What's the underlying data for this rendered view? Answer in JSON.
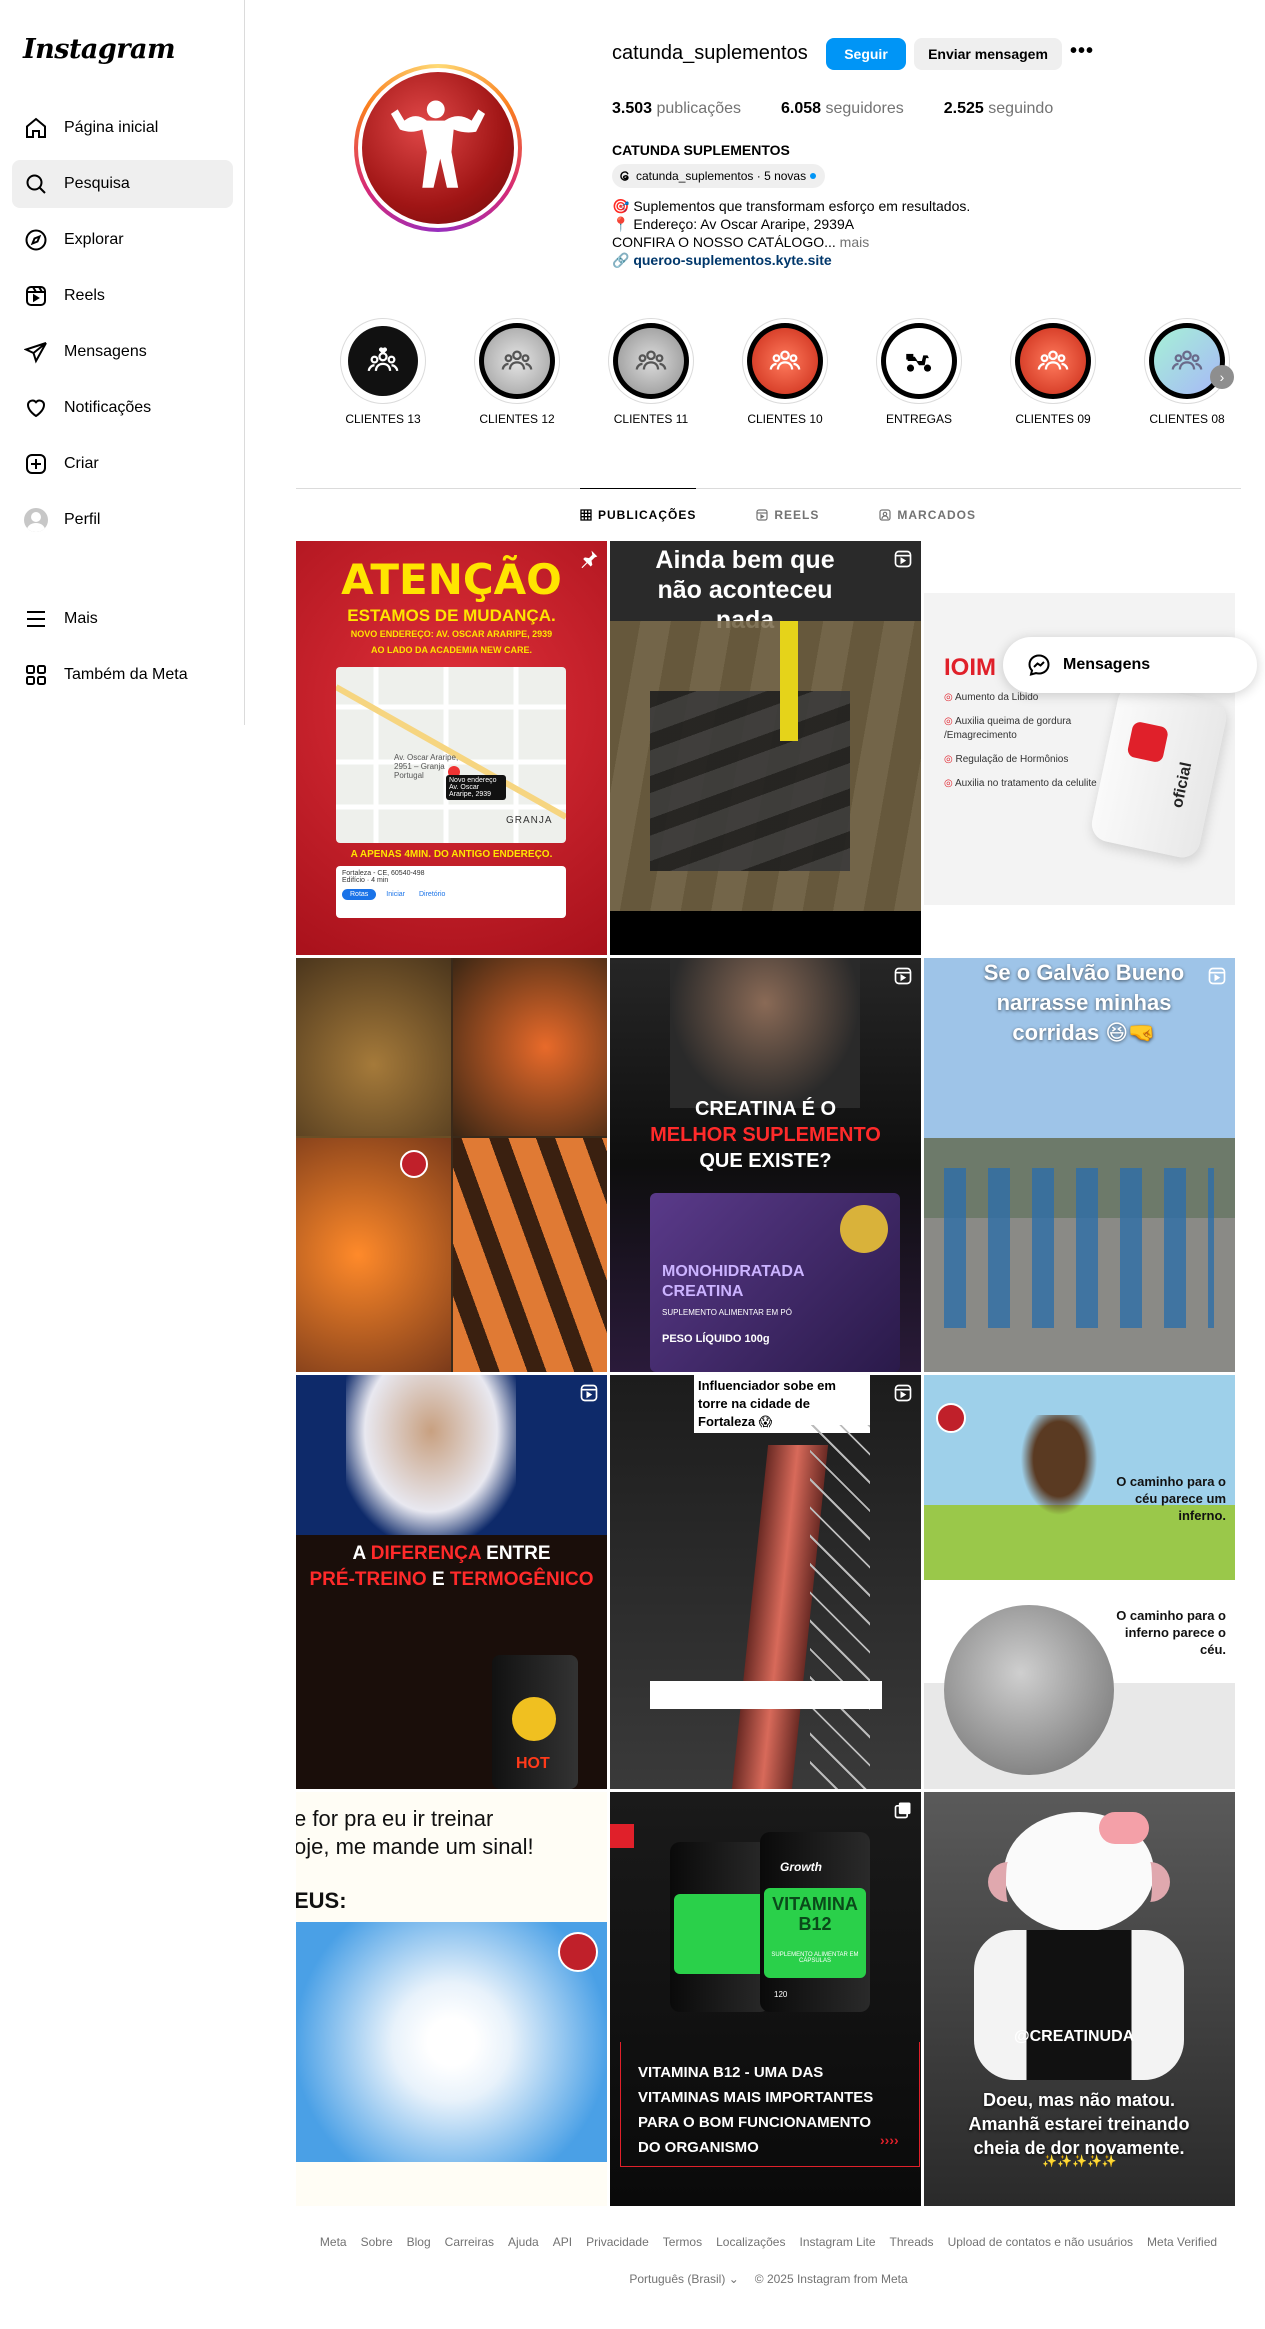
{
  "sidebar": {
    "logo": "Instagram",
    "items": [
      {
        "label": "Página inicial",
        "icon": "home-icon"
      },
      {
        "label": "Pesquisa",
        "icon": "search-icon",
        "active": true
      },
      {
        "label": "Explorar",
        "icon": "compass-icon"
      },
      {
        "label": "Reels",
        "icon": "reels-icon"
      },
      {
        "label": "Mensagens",
        "icon": "send-icon"
      },
      {
        "label": "Notificações",
        "icon": "heart-icon"
      },
      {
        "label": "Criar",
        "icon": "plus-square-icon"
      },
      {
        "label": "Perfil",
        "icon": "avatar"
      }
    ],
    "bottom": [
      {
        "label": "Mais",
        "icon": "menu-icon"
      },
      {
        "label": "Também da Meta",
        "icon": "meta-apps-icon"
      }
    ]
  },
  "profile": {
    "username": "catunda_suplementos",
    "follow_label": "Seguir",
    "message_label": "Enviar mensagem",
    "more_label": "•••",
    "posts_count": "3.503",
    "posts_label": "publicações",
    "followers_count": "6.058",
    "followers_label": "seguidores",
    "following_count": "2.525",
    "following_label": "seguindo",
    "full_name": "CATUNDA SUPLEMENTOS",
    "threads_chip": "catunda_suplementos · 5 novas",
    "bio_line1": "Suplementos que transformam esforço em resultados.",
    "bio_line2": "Endereço: Av Oscar Araripe, 2939A",
    "bio_line3": "CONFIRA O NOSSO CATÁLOGO...",
    "bio_more": "mais",
    "bio_link": "queroo-suplementos.kyte.site",
    "accent_color": "#0095f6"
  },
  "highlights": [
    {
      "label": "CLIENTES 13",
      "color": "#111111"
    },
    {
      "label": "CLIENTES 12",
      "color": "#b8b8b8"
    },
    {
      "label": "CLIENTES 11",
      "color": "#a9a9a9"
    },
    {
      "label": "CLIENTES 10",
      "color": "#e0442b"
    },
    {
      "label": "ENTREGAS",
      "color": "#ffffff"
    },
    {
      "label": "CLIENTES 09",
      "color": "#e0442b"
    },
    {
      "label": "CLIENTES 08",
      "color": "#7fd6c8"
    }
  ],
  "tabs": [
    {
      "label": "PUBLICAÇÕES",
      "active": true
    },
    {
      "label": "REELS"
    },
    {
      "label": "MARCADOS"
    }
  ],
  "posts": {
    "p1": {
      "title": "ATENÇÃO",
      "sub": "ESTAMOS DE MUDANÇA.",
      "addr": "NOVO ENDEREÇO: AV. OSCAR ARARIPE, 2939",
      "near": "AO LADO DA ACADEMIA NEW CARE.",
      "map_label": "Av. Oscar Araripe, 2951 – Granja Portugal",
      "map_pin": "Novo endereço Av. Oscar Araripe, 2939",
      "map_granja": "GRANJA",
      "foot": "A APENAS 4MIN. DO ANTIGO ENDEREÇO.",
      "card_line1": "Fortaleza - CE, 60540-498",
      "card_line2": "Edifício · 4 min",
      "card_rotas": "Rotas",
      "card_iniciar": "Iniciar",
      "card_diretorio": "Diretório"
    },
    "p2": {
      "title": "Ainda bem que não aconteceu nada"
    },
    "p3": {
      "brand": "IOIM",
      "b1": "Aumento da Libido",
      "b2": "Auxilia queima de gordura /Emagrecimento",
      "b3": "Regulação de Hormônios",
      "b4": "Auxilia no tratamento da celulite",
      "bottle": "oficial"
    },
    "p5": {
      "l1": "CREATINA É O",
      "l2": "MELHOR SUPLEMENTO",
      "l3": "QUE EXISTE?",
      "pack1": "MONOHIDRATADA",
      "pack2": "CREATINA",
      "pack3": "SUPLEMENTO ALIMENTAR EM PÓ",
      "pack4": "PESO LÍQUIDO 100g"
    },
    "p6": {
      "title": "Se o Galvão Bueno narrasse minhas corridas 😆🤜"
    },
    "p7": {
      "l1a": "A ",
      "l1b": "DIFERENÇA",
      "l1c": " ENTRE",
      "l2a": "PRÉ-TREINO",
      "l2b": " E ",
      "l2c": "TERMOGÊNICO",
      "can": "HOT"
    },
    "p8": {
      "title": "Influenciador sobe em torre na cidade de Fortaleza 😱"
    },
    "p9": {
      "top": "O caminho para o céu parece um inferno.",
      "bottom": "O caminho para o inferno parece o céu."
    },
    "p10": {
      "l1": "e for pra eu ir treinar",
      "l2": "oje, me mande um sinal!",
      "l3": "EUS:"
    },
    "p11": {
      "brand": "Growth",
      "label": "VITAMINA B12",
      "sub": "SUPLEMENTO ALIMENTAR EM CÁPSULAS",
      "count": "120",
      "text": "VITAMINA B12 - UMA DAS VITAMINAS MAIS IMPORTANTES PARA O BOM FUNCIONAMENTO DO ORGANISMO"
    },
    "p12": {
      "handle": "@CREATINUDA",
      "text": "Doeu, mas não matou. Amanhã estarei treinando cheia de dor novamente.",
      "stars": "✨✨✨✨✨"
    }
  },
  "messages_bubble": "Mensagens",
  "footer": {
    "links": [
      "Meta",
      "Sobre",
      "Blog",
      "Carreiras",
      "Ajuda",
      "API",
      "Privacidade",
      "Termos",
      "Localizações",
      "Instagram Lite",
      "Threads",
      "Upload de contatos e não usuários",
      "Meta Verified"
    ],
    "language": "Português (Brasil)",
    "copyright": "© 2025 Instagram from Meta"
  }
}
